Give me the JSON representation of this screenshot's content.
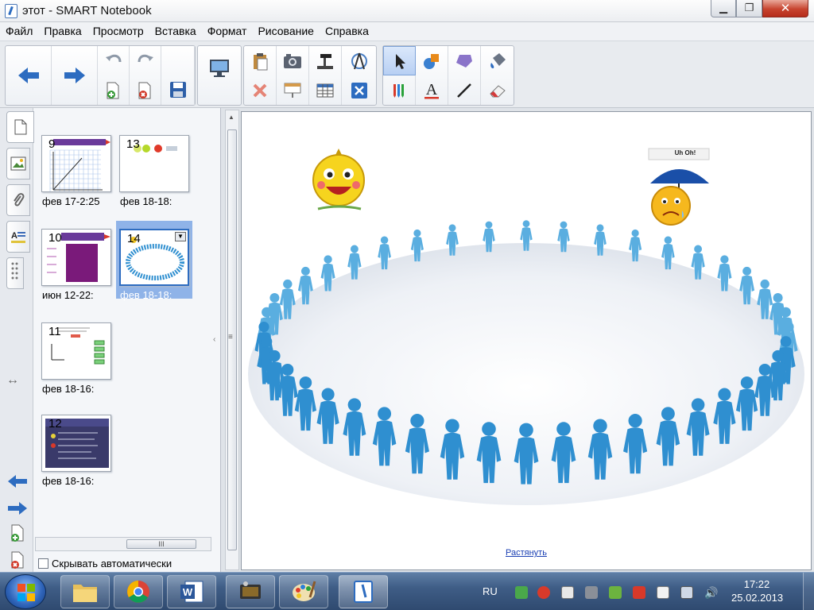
{
  "window": {
    "title": "этот - SMART Notebook",
    "minimize_glyph": "▁",
    "maximize_glyph": "❐",
    "close_glyph": "✕"
  },
  "menu": [
    "Файл",
    "Правка",
    "Просмотр",
    "Вставка",
    "Формат",
    "Рисование",
    "Справка"
  ],
  "toolbar": {
    "icons": [
      "back-arrow-icon",
      "forward-arrow-icon",
      "undo-icon",
      "redo-icon",
      "new-page-icon",
      "delete-page-icon",
      "save-icon",
      "display-screen-icon",
      "paste-icon",
      "screen-capture-icon",
      "document-camera-icon",
      "compass-icon",
      "delete-icon",
      "screen-shade-icon",
      "table-icon",
      "full-screen-icon",
      "select-icon",
      "shapes-icon",
      "eraser-polygon-icon",
      "fill-icon",
      "pens-icon",
      "text-icon",
      "line-icon",
      "eraser-icon"
    ],
    "accent": "#2d6cc0"
  },
  "side_panel": {
    "tabs": [
      "page-sorter-icon",
      "gallery-icon",
      "attachments-icon",
      "properties-icon"
    ],
    "thumbnails": [
      {
        "number": "9",
        "label": "фев 17-2:25"
      },
      {
        "number": "13",
        "label": "фев 18-18:"
      },
      {
        "number": "10",
        "label": "июн 12-22:"
      },
      {
        "number": "14",
        "label": "фев 18-18:"
      },
      {
        "number": "11",
        "label": "фев 18-16:"
      },
      {
        "number": "12",
        "label": "фев 18-16:"
      }
    ],
    "scroll_thumb_label": "III",
    "autohide_label": "Скрывать автоматически"
  },
  "canvas": {
    "uh_oh_label": "Uh Oh!",
    "stretch_link": "Растянуть",
    "figure_color": "#2f8fd0"
  },
  "taskbar": {
    "apps": [
      "explorer-icon",
      "chrome-icon",
      "word-icon",
      "document-camera-app-icon",
      "paint-icon",
      "smart-notebook-icon"
    ],
    "language": "RU",
    "time": "17:22",
    "date": "25.02.2013"
  }
}
